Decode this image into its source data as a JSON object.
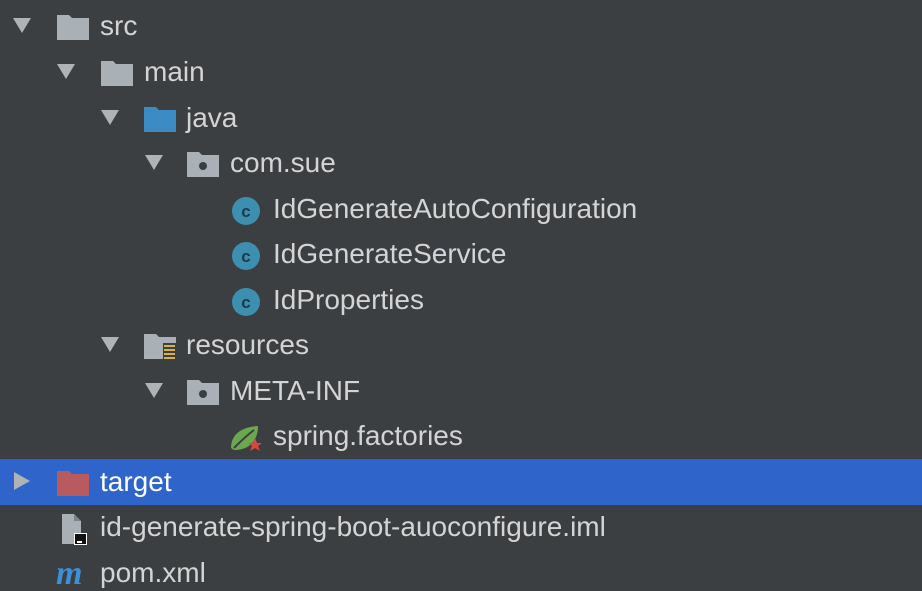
{
  "tree": {
    "items": [
      {
        "label": "src",
        "expanded": true,
        "icon": "folder-icon"
      },
      {
        "label": "main",
        "expanded": true,
        "icon": "folder-icon"
      },
      {
        "label": "java",
        "expanded": true,
        "icon": "source-folder-icon"
      },
      {
        "label": "com.sue",
        "expanded": true,
        "icon": "package-icon"
      },
      {
        "label": "IdGenerateAutoConfiguration",
        "icon": "java-class-icon"
      },
      {
        "label": "IdGenerateService",
        "icon": "java-class-icon"
      },
      {
        "label": "IdProperties",
        "icon": "java-class-icon"
      },
      {
        "label": "resources",
        "expanded": true,
        "icon": "resources-folder-icon"
      },
      {
        "label": "META-INF",
        "expanded": true,
        "icon": "package-icon"
      },
      {
        "label": "spring.factories",
        "icon": "spring-factories-icon"
      },
      {
        "label": "target",
        "expanded": false,
        "selected": true,
        "icon": "excluded-folder-icon"
      },
      {
        "label": "id-generate-spring-boot-auoconfigure.iml",
        "icon": "iml-file-icon"
      },
      {
        "label": "pom.xml",
        "icon": "maven-icon"
      }
    ]
  },
  "colors": {
    "background": "#3c3f41",
    "selection": "#2f65ca",
    "folder": "#a9b0b6",
    "source_folder": "#3d8bc4",
    "excluded_folder": "#b95a5e",
    "class_icon": "#3d8fb0",
    "spring": "#6aa84f"
  }
}
